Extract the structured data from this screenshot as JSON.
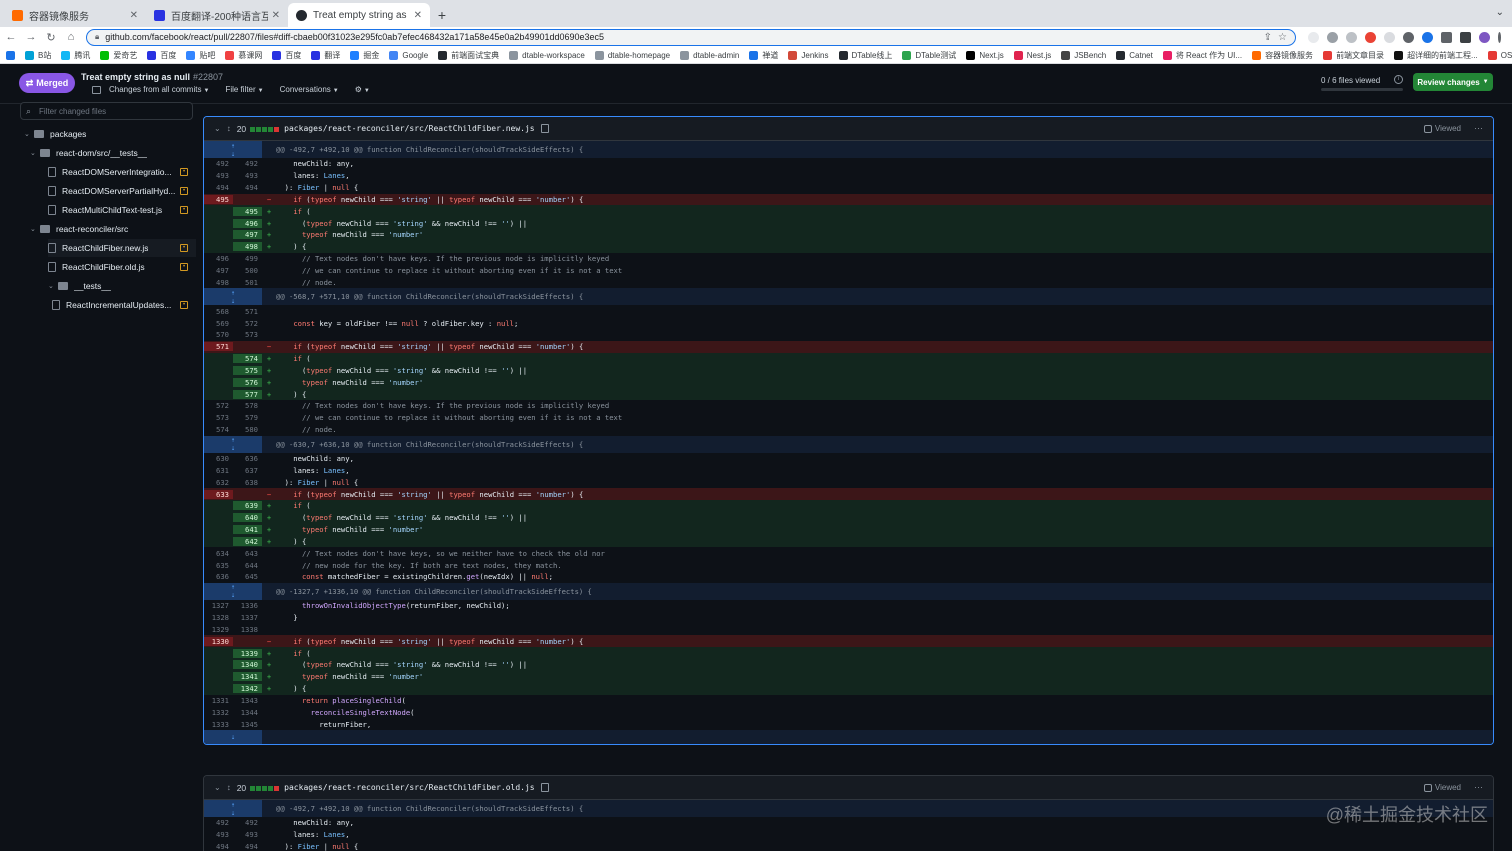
{
  "browser": {
    "tabs": [
      {
        "title": "容器镜像服务",
        "favicon_color": "#ff6a00"
      },
      {
        "title": "百度翻译-200种语言互译、沟通",
        "favicon_color": "#2932e1"
      },
      {
        "title": "Treat empty string as null by s",
        "favicon_color": "#24292f",
        "active": true
      }
    ],
    "url": "github.com/facebook/react/pull/22807/files#diff-cbaeb00f31023e295fc0ab7efec468432a171a58e45e0a2b49901dd0690e3ec5",
    "bookmarks": [
      "B站",
      "腾讯",
      "爱奇艺",
      "百度",
      "贴吧",
      "慕课网",
      "百度",
      "翻译",
      "掘金",
      "Google",
      "前端面试宝典",
      "dtable-workspace",
      "dtable-homepage",
      "dtable-admin",
      "禅道",
      "Jenkins",
      "DTable线上",
      "DTable测试",
      "Next.js",
      "Nest.js",
      "JSBench",
      "Catnet",
      "将 React 作为 UI...",
      "容器镜像服务",
      "前端文章目录",
      "超详细的前端工程...",
      "OSS Insight"
    ]
  },
  "pr": {
    "state": "Merged",
    "title": "Treat empty string as null",
    "number": "#22807",
    "changes_from": "Changes from all commits",
    "file_filter": "File filter",
    "conversations": "Conversations",
    "files_viewed": "0 / 6 files viewed",
    "review_button": "Review changes"
  },
  "sidebar": {
    "filter_placeholder": "Filter changed files",
    "tree": [
      {
        "label": "packages",
        "type": "folder",
        "depth": 0
      },
      {
        "label": "react-dom/src/__tests__",
        "type": "folder",
        "depth": 1
      },
      {
        "label": "ReactDOMServerIntegratio...",
        "type": "file",
        "depth": 2
      },
      {
        "label": "ReactDOMServerPartialHyd...",
        "type": "file",
        "depth": 2
      },
      {
        "label": "ReactMultiChildText-test.js",
        "type": "file",
        "depth": 2
      },
      {
        "label": "react-reconciler/src",
        "type": "folder",
        "depth": 1
      },
      {
        "label": "ReactChildFiber.new.js",
        "type": "file",
        "depth": 2,
        "selected": true
      },
      {
        "label": "ReactChildFiber.old.js",
        "type": "file",
        "depth": 2
      },
      {
        "label": "__tests__",
        "type": "folder",
        "depth": 2
      },
      {
        "label": "ReactIncrementalUpdates...",
        "type": "file",
        "depth": 3
      }
    ]
  },
  "files": [
    {
      "count": "20",
      "path": "packages/react-reconciler/src/ReactChildFiber.new.js",
      "viewed_label": "Viewed",
      "lines": [
        {
          "t": "hunk",
          "code": "@@ -492,7 +492,10 @@ function ChildReconciler(shouldTrackSideEffects) {"
        },
        {
          "t": "ctx",
          "o": "492",
          "n": "492",
          "code": "    newChild: any,"
        },
        {
          "t": "ctx",
          "o": "493",
          "n": "493",
          "code": "    lanes: Lanes,"
        },
        {
          "t": "ctx",
          "o": "494",
          "n": "494",
          "code": "  ): Fiber | null {"
        },
        {
          "t": "del",
          "o": "495",
          "n": "",
          "code": "    if (typeof newChild === 'string' || typeof newChild === 'number') {"
        },
        {
          "t": "add",
          "o": "",
          "n": "495",
          "code": "    if ("
        },
        {
          "t": "add",
          "o": "",
          "n": "496",
          "code": "      (typeof newChild === 'string' && newChild !== '') ||"
        },
        {
          "t": "add",
          "o": "",
          "n": "497",
          "code": "      typeof newChild === 'number'"
        },
        {
          "t": "add",
          "o": "",
          "n": "498",
          "code": "    ) {"
        },
        {
          "t": "ctx",
          "o": "496",
          "n": "499",
          "code": "      // Text nodes don't have keys. If the previous node is implicitly keyed"
        },
        {
          "t": "ctx",
          "o": "497",
          "n": "500",
          "code": "      // we can continue to replace it without aborting even if it is not a text"
        },
        {
          "t": "ctx",
          "o": "498",
          "n": "501",
          "code": "      // node."
        },
        {
          "t": "hunk",
          "code": "@@ -568,7 +571,10 @@ function ChildReconciler(shouldTrackSideEffects) {"
        },
        {
          "t": "ctx",
          "o": "568",
          "n": "571",
          "code": ""
        },
        {
          "t": "ctx",
          "o": "569",
          "n": "572",
          "code": "    const key = oldFiber !== null ? oldFiber.key : null;"
        },
        {
          "t": "ctx",
          "o": "570",
          "n": "573",
          "code": ""
        },
        {
          "t": "del",
          "o": "571",
          "n": "",
          "code": "    if (typeof newChild === 'string' || typeof newChild === 'number') {"
        },
        {
          "t": "add",
          "o": "",
          "n": "574",
          "code": "    if ("
        },
        {
          "t": "add",
          "o": "",
          "n": "575",
          "code": "      (typeof newChild === 'string' && newChild !== '') ||"
        },
        {
          "t": "add",
          "o": "",
          "n": "576",
          "code": "      typeof newChild === 'number'"
        },
        {
          "t": "add",
          "o": "",
          "n": "577",
          "code": "    ) {"
        },
        {
          "t": "ctx",
          "o": "572",
          "n": "578",
          "code": "      // Text nodes don't have keys. If the previous node is implicitly keyed"
        },
        {
          "t": "ctx",
          "o": "573",
          "n": "579",
          "code": "      // we can continue to replace it without aborting even if it is not a text"
        },
        {
          "t": "ctx",
          "o": "574",
          "n": "580",
          "code": "      // node."
        },
        {
          "t": "hunk",
          "code": "@@ -630,7 +636,10 @@ function ChildReconciler(shouldTrackSideEffects) {"
        },
        {
          "t": "ctx",
          "o": "630",
          "n": "636",
          "code": "    newChild: any,"
        },
        {
          "t": "ctx",
          "o": "631",
          "n": "637",
          "code": "    lanes: Lanes,"
        },
        {
          "t": "ctx",
          "o": "632",
          "n": "638",
          "code": "  ): Fiber | null {"
        },
        {
          "t": "del",
          "o": "633",
          "n": "",
          "code": "    if (typeof newChild === 'string' || typeof newChild === 'number') {"
        },
        {
          "t": "add",
          "o": "",
          "n": "639",
          "code": "    if ("
        },
        {
          "t": "add",
          "o": "",
          "n": "640",
          "code": "      (typeof newChild === 'string' && newChild !== '') ||"
        },
        {
          "t": "add",
          "o": "",
          "n": "641",
          "code": "      typeof newChild === 'number'"
        },
        {
          "t": "add",
          "o": "",
          "n": "642",
          "code": "    ) {"
        },
        {
          "t": "ctx",
          "o": "634",
          "n": "643",
          "code": "      // Text nodes don't have keys, so we neither have to check the old nor"
        },
        {
          "t": "ctx",
          "o": "635",
          "n": "644",
          "code": "      // new node for the key. If both are text nodes, they match."
        },
        {
          "t": "ctx",
          "o": "636",
          "n": "645",
          "code": "      const matchedFiber = existingChildren.get(newIdx) || null;"
        },
        {
          "t": "hunk",
          "code": "@@ -1327,7 +1336,10 @@ function ChildReconciler(shouldTrackSideEffects) {"
        },
        {
          "t": "ctx",
          "o": "1327",
          "n": "1336",
          "code": "      throwOnInvalidObjectType(returnFiber, newChild);"
        },
        {
          "t": "ctx",
          "o": "1328",
          "n": "1337",
          "code": "    }"
        },
        {
          "t": "ctx",
          "o": "1329",
          "n": "1338",
          "code": ""
        },
        {
          "t": "del",
          "o": "1330",
          "n": "",
          "code": "    if (typeof newChild === 'string' || typeof newChild === 'number') {"
        },
        {
          "t": "add",
          "o": "",
          "n": "1339",
          "code": "    if ("
        },
        {
          "t": "add",
          "o": "",
          "n": "1340",
          "code": "      (typeof newChild === 'string' && newChild !== '') ||"
        },
        {
          "t": "add",
          "o": "",
          "n": "1341",
          "code": "      typeof newChild === 'number'"
        },
        {
          "t": "add",
          "o": "",
          "n": "1342",
          "code": "    ) {"
        },
        {
          "t": "ctx",
          "o": "1331",
          "n": "1343",
          "code": "      return placeSingleChild("
        },
        {
          "t": "ctx",
          "o": "1332",
          "n": "1344",
          "code": "        reconcileSingleTextNode("
        },
        {
          "t": "ctx",
          "o": "1333",
          "n": "1345",
          "code": "          returnFiber,"
        },
        {
          "t": "tail"
        }
      ]
    },
    {
      "count": "20",
      "path": "packages/react-reconciler/src/ReactChildFiber.old.js",
      "viewed_label": "Viewed",
      "lines": [
        {
          "t": "hunk",
          "code": "@@ -492,7 +492,10 @@ function ChildReconciler(shouldTrackSideEffects) {"
        },
        {
          "t": "ctx",
          "o": "492",
          "n": "492",
          "code": "    newChild: any,"
        },
        {
          "t": "ctx",
          "o": "493",
          "n": "493",
          "code": "    lanes: Lanes,"
        },
        {
          "t": "ctx",
          "o": "494",
          "n": "494",
          "code": "  ): Fiber | null {"
        }
      ]
    }
  ],
  "watermark": "@稀土掘金技术社区"
}
